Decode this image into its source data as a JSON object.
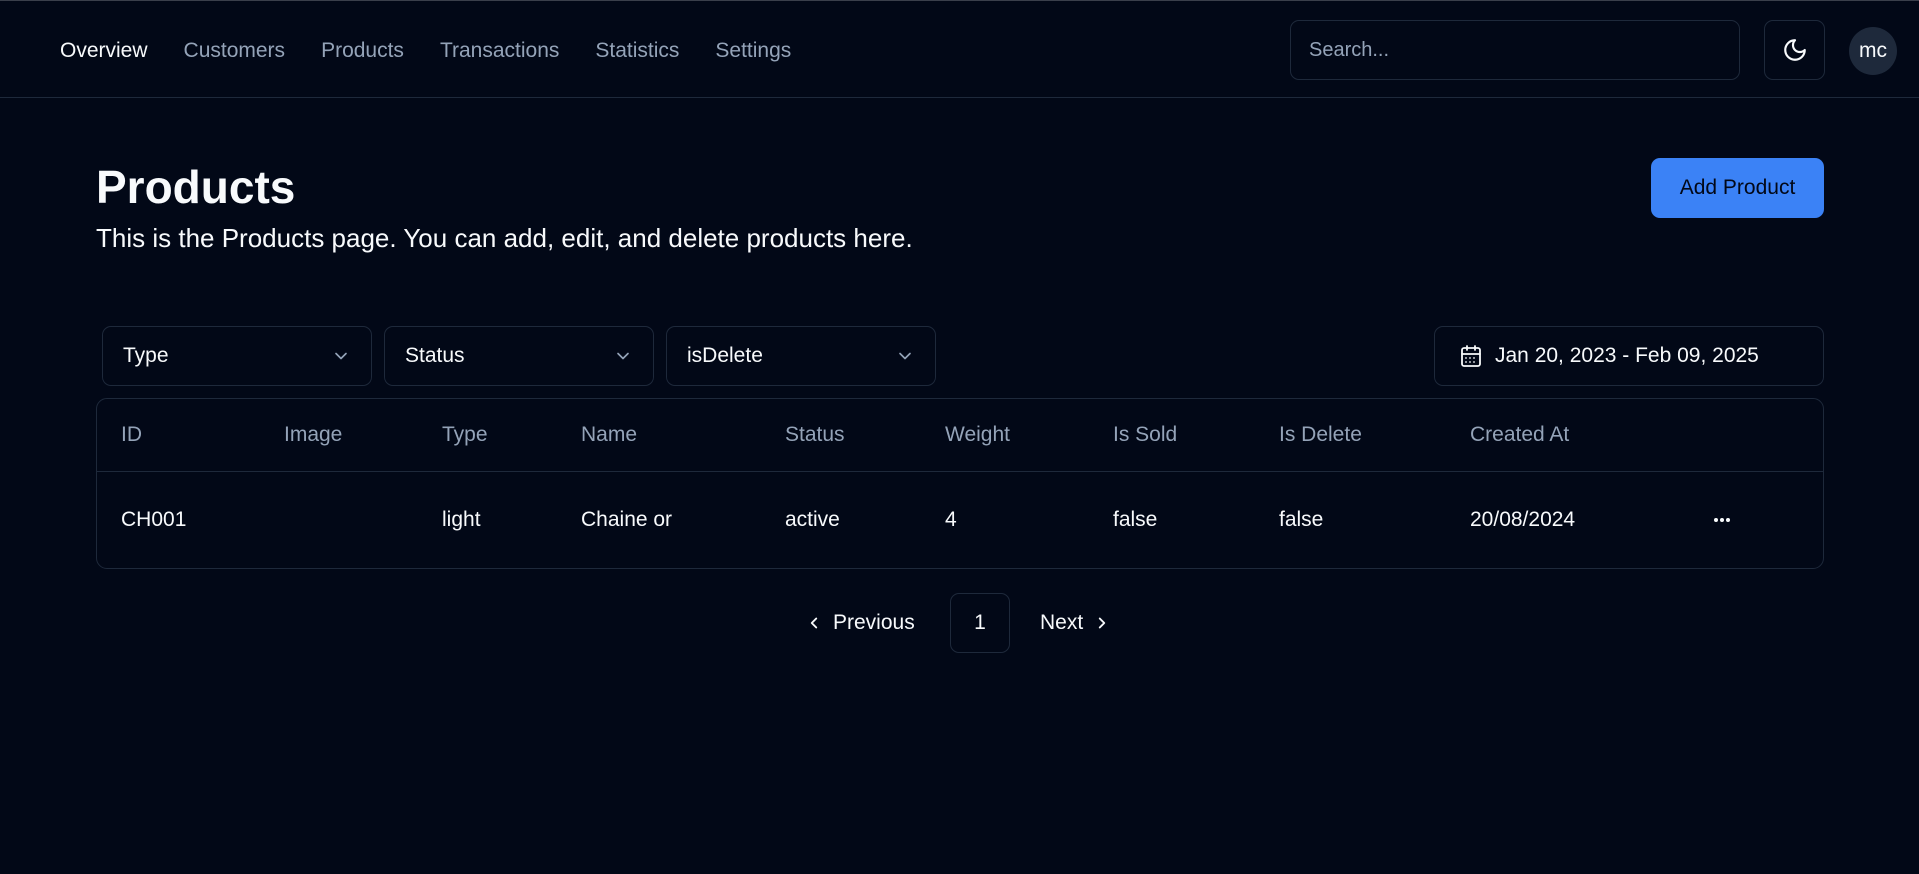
{
  "nav": {
    "items": [
      {
        "label": "Overview",
        "active": true
      },
      {
        "label": "Customers",
        "active": false
      },
      {
        "label": "Products",
        "active": false
      },
      {
        "label": "Transactions",
        "active": false
      },
      {
        "label": "Statistics",
        "active": false
      },
      {
        "label": "Settings",
        "active": false
      }
    ]
  },
  "search": {
    "placeholder": "Search...",
    "value": ""
  },
  "theme_toggle": {
    "icon": "moon-icon"
  },
  "avatar": {
    "initials": "mc"
  },
  "page": {
    "title": "Products",
    "description": "This is the Products page. You can add, edit, and delete products here."
  },
  "add_button": {
    "label": "Add Product"
  },
  "filters": {
    "type": {
      "label": "Type",
      "icon": "chevron-down-icon"
    },
    "status": {
      "label": "Status",
      "icon": "chevron-down-icon"
    },
    "is_delete": {
      "label": "isDelete",
      "icon": "chevron-down-icon"
    },
    "date_range": {
      "label": "Jan 20, 2023 - Feb 09, 2025",
      "icon": "calendar-icon"
    }
  },
  "table": {
    "columns": [
      "ID",
      "Image",
      "Type",
      "Name",
      "Status",
      "Weight",
      "Is Sold",
      "Is Delete",
      "Created At"
    ],
    "rows": [
      {
        "id": "CH001",
        "image": "",
        "type": "light",
        "name": "Chaine or",
        "status": "active",
        "weight": "4",
        "is_sold": "false",
        "is_delete": "false",
        "created_at": "20/08/2024",
        "actions_icon": "more-horizontal-icon"
      }
    ]
  },
  "pagination": {
    "previous_label": "Previous",
    "next_label": "Next",
    "current_page": "1"
  },
  "colors": {
    "background": "#020817",
    "border": "#1e293b",
    "muted_text": "#94a3b8",
    "text": "#f8fafc",
    "accent": "#3b82f6"
  }
}
